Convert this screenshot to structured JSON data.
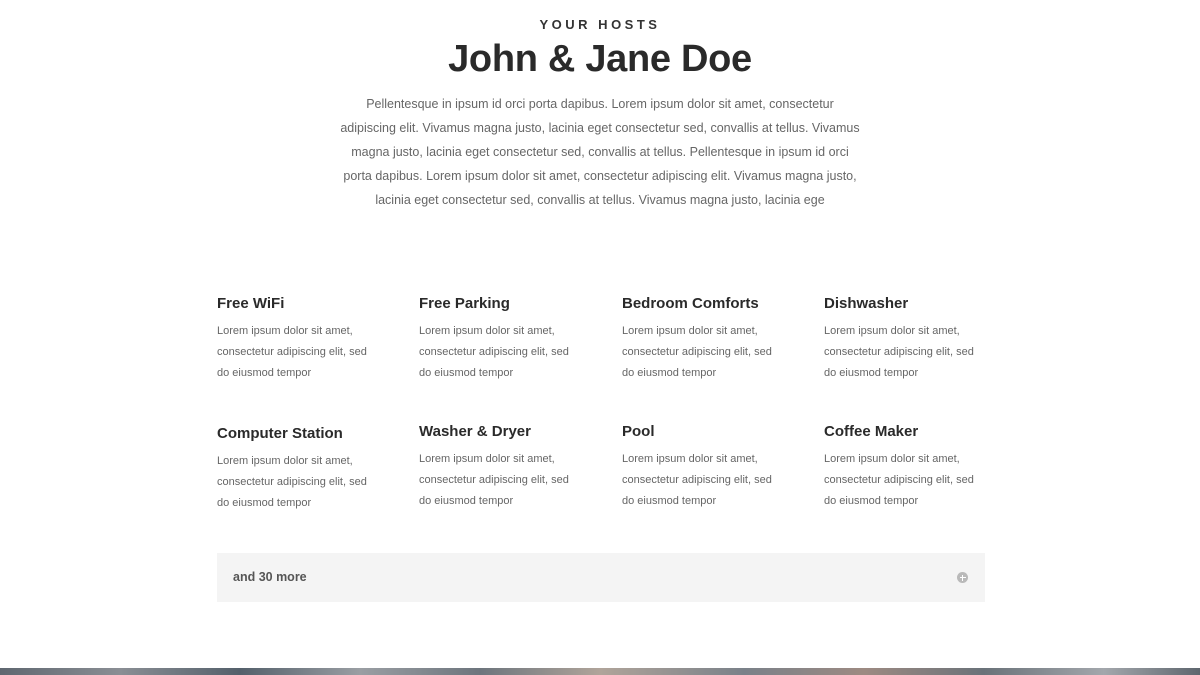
{
  "hosts": {
    "eyebrow": "YOUR HOSTS",
    "title": "John & Jane Doe",
    "intro_lines": [
      "Pellentesque in ipsum id orci porta dapibus. Lorem ipsum dolor sit amet, consectetur",
      "adipiscing elit. Vivamus magna justo, lacinia eget consectetur sed, convallis at tellus. Vivamus",
      "magna justo, lacinia eget consectetur sed, convallis at tellus.  Pellentesque in ipsum id orci",
      "porta dapibus. Lorem ipsum dolor sit amet, consectetur adipiscing elit. Vivamus magna justo,",
      "lacinia eget consectetur sed, convallis at tellus. Vivamus magna justo, lacinia ege"
    ]
  },
  "amenities": [
    {
      "title": "Free WiFi",
      "desc_lines": [
        "Lorem ipsum dolor sit amet,",
        "consectetur adipiscing elit, sed",
        "do eiusmod tempor"
      ]
    },
    {
      "title": "Free Parking",
      "desc_lines": [
        "Lorem ipsum dolor sit amet,",
        "consectetur adipiscing elit, sed",
        "do eiusmod tempor"
      ]
    },
    {
      "title": "Bedroom Comforts",
      "desc_lines": [
        "Lorem ipsum dolor sit amet,",
        "consectetur adipiscing elit, sed",
        "do eiusmod tempor"
      ]
    },
    {
      "title": "Dishwasher",
      "desc_lines": [
        "Lorem ipsum dolor sit amet,",
        "consectetur adipiscing elit, sed",
        "do eiusmod tempor"
      ]
    },
    {
      "title": "Computer Station",
      "desc_lines": [
        "Lorem ipsum dolor sit amet,",
        "consectetur adipiscing elit, sed",
        "do eiusmod tempor"
      ]
    },
    {
      "title": "Washer & Dryer",
      "desc_lines": [
        "Lorem ipsum dolor sit amet,",
        "consectetur adipiscing elit, sed",
        "do eiusmod tempor"
      ]
    },
    {
      "title": "Pool",
      "desc_lines": [
        "Lorem ipsum dolor sit amet,",
        "consectetur adipiscing elit, sed",
        "do eiusmod tempor"
      ]
    },
    {
      "title": "Coffee Maker",
      "desc_lines": [
        "Lorem ipsum dolor sit amet,",
        "consectetur adipiscing elit, sed",
        "do eiusmod tempor"
      ]
    }
  ],
  "more_toggle": {
    "label": "and 30 more",
    "icon": "plus-circle-icon"
  }
}
